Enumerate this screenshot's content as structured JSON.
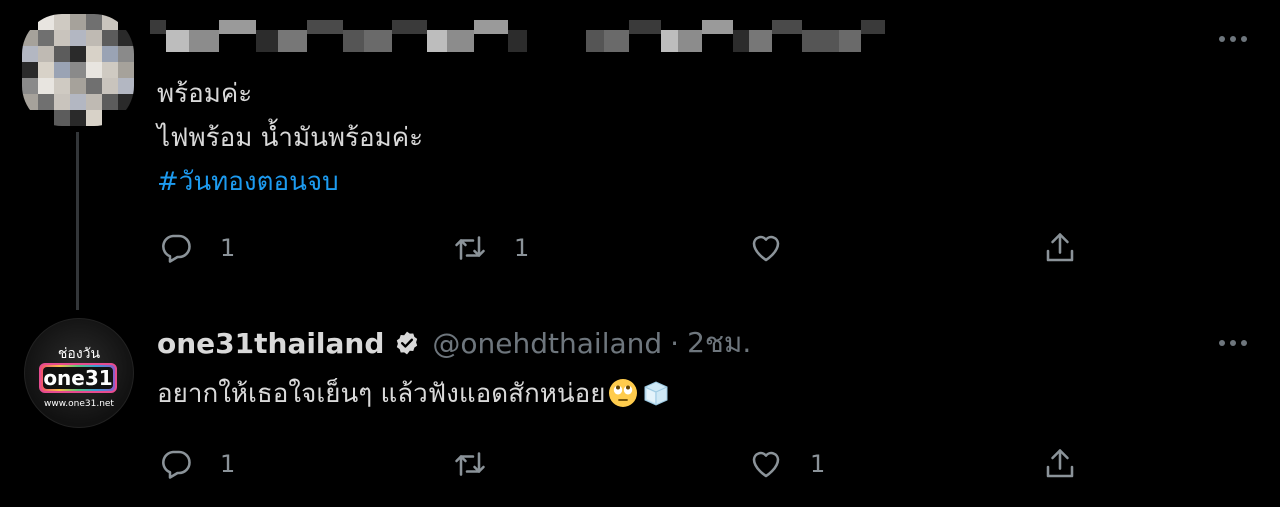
{
  "tweet1": {
    "avatar_icon": "blurred-avatar",
    "lines": [
      "พร้อมค่ะ",
      "ไฟพร้อม น้ำมันพร้อมค่ะ"
    ],
    "hashtag": "#วันทองตอนจบ",
    "reply_count": "1",
    "retweet_count": "1",
    "like_count": "",
    "more_icon": "more-horizontal-icon"
  },
  "tweet2": {
    "avatar": {
      "top_text": "ช่องวัน",
      "brand_text": "one31",
      "url_text": "www.one31.net"
    },
    "display_name": "one31thailand",
    "verified_icon": "verified-badge-icon",
    "handle": "@onehdthailand",
    "separator": "·",
    "time": "2ชม.",
    "text": "อยากให้เธอใจเย็นๆ แล้วฟังแอดสักหน่อย",
    "emojis": [
      "face-with-rolling-eyes-emoji",
      "ice-cube-emoji"
    ],
    "reply_count": "1",
    "retweet_count": "",
    "like_count": "1",
    "more_icon": "more-horizontal-icon"
  },
  "colors": {
    "background": "#000000",
    "text": "#d9d9d9",
    "secondary": "#6e767d",
    "link": "#1d9bf0",
    "thread_line": "#333639"
  }
}
